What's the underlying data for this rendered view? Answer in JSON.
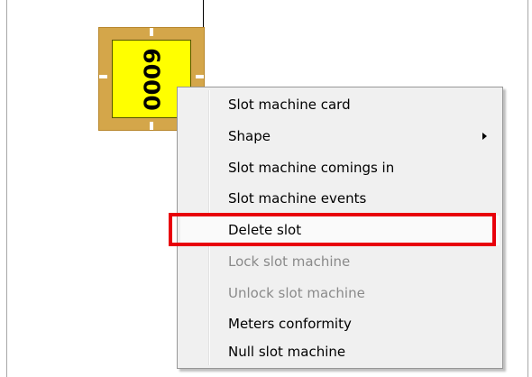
{
  "slot": {
    "label": "6000",
    "colors": {
      "fill": "#ffff00",
      "frame": "#d4a64a"
    }
  },
  "context_menu": {
    "items": [
      {
        "label": "Slot machine card",
        "enabled": true,
        "has_submenu": false
      },
      {
        "label": "Shape",
        "enabled": true,
        "has_submenu": true
      },
      {
        "label": "Slot machine comings in",
        "enabled": true,
        "has_submenu": false
      },
      {
        "label": "Slot machine events",
        "enabled": true,
        "has_submenu": false
      },
      {
        "label": "Delete slot",
        "enabled": true,
        "has_submenu": false,
        "highlighted": true
      },
      {
        "label": "Lock slot machine",
        "enabled": false,
        "has_submenu": false
      },
      {
        "label": "Unlock slot machine",
        "enabled": false,
        "has_submenu": false
      },
      {
        "label": "Meters conformity",
        "enabled": true,
        "has_submenu": false
      },
      {
        "label": "Null slot machine",
        "enabled": true,
        "has_submenu": false
      }
    ]
  },
  "annotation": {
    "highlight_color": "#e8000b",
    "target": "Delete slot"
  }
}
